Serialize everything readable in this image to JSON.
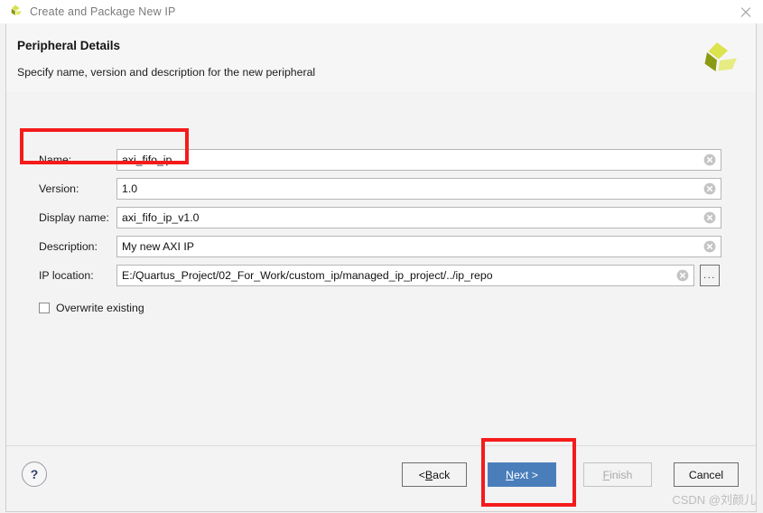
{
  "window": {
    "title": "Create and Package New IP",
    "icon": "vivado-logo-icon",
    "close_icon": "close-icon"
  },
  "banner": {
    "title": "Peripheral Details",
    "subtitle": "Specify name, version and description for the new peripheral",
    "logo_icon": "vivado-logo-icon"
  },
  "form": {
    "fields": [
      {
        "label": "Name:",
        "value": "axi_fifo_ip",
        "clear_icon": "clear-circle-icon"
      },
      {
        "label": "Version:",
        "value": "1.0",
        "clear_icon": "clear-circle-icon"
      },
      {
        "label": "Display name:",
        "value": "axi_fifo_ip_v1.0",
        "clear_icon": "clear-circle-icon"
      },
      {
        "label": "Description:",
        "value": "My new AXI IP",
        "clear_icon": "clear-circle-icon"
      },
      {
        "label": "IP location:",
        "value": "E:/Quartus_Project/02_For_Work/custom_ip/managed_ip_project/../ip_repo",
        "clear_icon": "clear-circle-icon"
      }
    ],
    "browse_label": "...",
    "checkbox": {
      "label": "Overwrite existing",
      "checked": false
    }
  },
  "footer": {
    "help_label": "?",
    "buttons": [
      {
        "name": "back",
        "prefix": "< ",
        "mnemonic": "B",
        "suffix": "ack",
        "state": "enabled"
      },
      {
        "name": "next",
        "prefix": "",
        "mnemonic": "N",
        "suffix": "ext >",
        "state": "primary"
      },
      {
        "name": "finish",
        "prefix": "",
        "mnemonic": "F",
        "suffix": "inish",
        "state": "disabled"
      },
      {
        "name": "cancel",
        "prefix": "",
        "mnemonic": "",
        "suffix": "Cancel",
        "state": "enabled"
      }
    ]
  },
  "watermark": "CSDN @刘颜儿",
  "colors": {
    "primary_button": "#4a7ebb",
    "annotation": "#f51b1b",
    "logo_dark": "#8a9a12",
    "logo_light": "#d7e04a",
    "help_text": "#2c3d6b"
  }
}
